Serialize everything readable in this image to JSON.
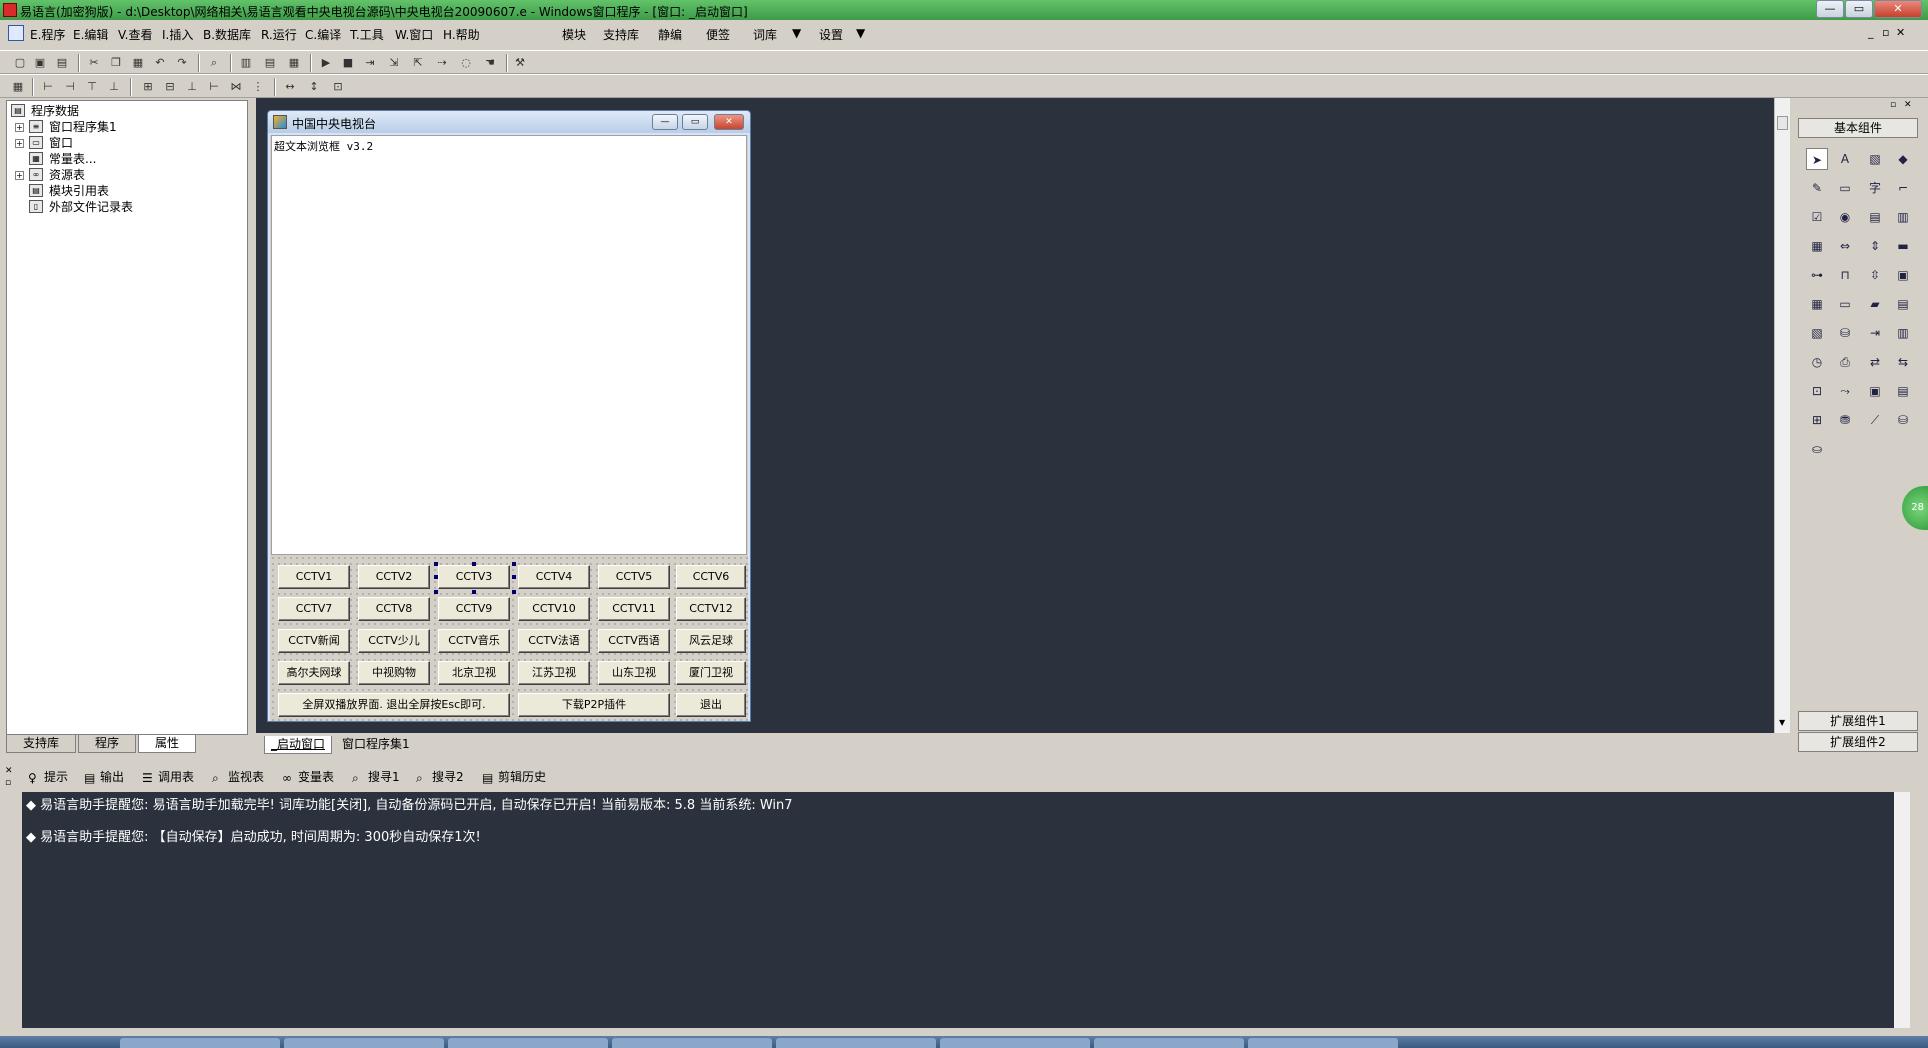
{
  "window": {
    "title": "易语言(加密狗版) - d:\\Desktop\\网络相关\\易语言观看中央电视台源码\\中央电视台20090607.e - Windows窗口程序 - [窗口: _启动窗口]",
    "btn_min": "—",
    "btn_max": "▭",
    "btn_close": "✕"
  },
  "menu": {
    "left": [
      "E.程序",
      "E.编辑",
      "V.查看",
      "I.插入",
      "B.数据库",
      "R.运行",
      "C.编译",
      "T.工具",
      "W.窗口",
      "H.帮助"
    ],
    "right": [
      "模块",
      "支持库",
      "静编",
      "便签",
      "词库",
      "设置"
    ]
  },
  "tree": {
    "root": "程序数据",
    "items": [
      "窗口程序集1",
      "窗口",
      "常量表...",
      "资源表",
      "模块引用表",
      "外部文件记录表"
    ]
  },
  "left_tabs": [
    "支持库",
    "程序",
    "属性"
  ],
  "form": {
    "title": "中国中央电视台",
    "browser_text": "超文本浏览框 v3.2",
    "buttons_row1": [
      "CCTV1",
      "CCTV2",
      "CCTV3",
      "CCTV4",
      "CCTV5",
      "CCTV6"
    ],
    "buttons_row2": [
      "CCTV7",
      "CCTV8",
      "CCTV9",
      "CCTV10",
      "CCTV11",
      "CCTV12"
    ],
    "buttons_row3": [
      "CCTV新闻",
      "CCTV少儿",
      "CCTV音乐",
      "CCTV法语",
      "CCTV西语",
      "风云足球"
    ],
    "buttons_row4": [
      "高尔夫网球",
      "中视购物",
      "北京卫视",
      "江苏卫视",
      "山东卫视",
      "厦门卫视"
    ],
    "fullscreen_btn": "全屏双播放界面. 退出全屏按Esc即可.",
    "download_btn": "下载P2P插件",
    "exit_btn": "退出"
  },
  "right_panel": {
    "header": "基本组件",
    "tab1": "扩展组件1",
    "tab2": "扩展组件2"
  },
  "editor_tabs": [
    "_启动窗口",
    "窗口程序集1"
  ],
  "bottom_tabs": [
    "提示",
    "输出",
    "调用表",
    "监视表",
    "变量表",
    "搜寻1",
    "搜寻2",
    "剪辑历史"
  ],
  "output_lines": [
    "易语言助手提醒您:  易语言助手加载完毕! 词库功能[关闭], 自动备份源码已开启, 自动保存已开启! 当前易版本: 5.8  当前系统: Win7",
    "易语言助手提醒您: 【自动保存】启动成功, 时间周期为: 300秒自动保存1次!"
  ],
  "side_badge": "28"
}
